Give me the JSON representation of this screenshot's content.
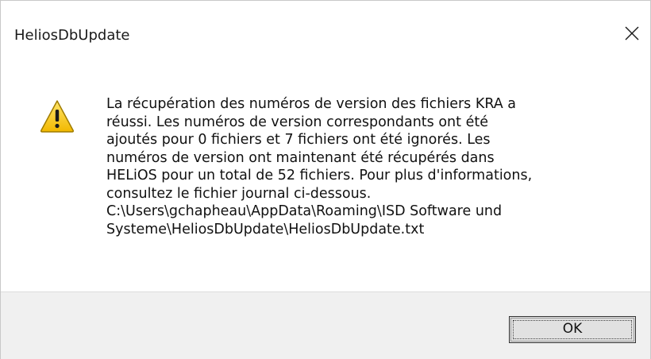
{
  "window": {
    "title": "HeliosDbUpdate",
    "close_icon": "close-icon"
  },
  "message": {
    "icon": "warning-icon",
    "text": "La récupération des numéros de version des fichiers KRA a\nréussi. Les numéros de version correspondants ont été\najoutés pour 0 fichiers et 7 fichiers ont été ignorés. Les\nnuméros de version ont maintenant été récupérés dans\nHELiOS pour un total de 52 fichiers. Pour plus d'informations,\nconsultez le fichier journal ci-dessous.\n C:\\Users\\gchapheau\\AppData\\Roaming\\ISD Software und\nSysteme\\HeliosDbUpdate\\HeliosDbUpdate.txt"
  },
  "buttons": {
    "ok_label": "OK"
  },
  "colors": {
    "warning_fill": "#f5c400",
    "warning_border": "#9a7a00",
    "footer_bg": "#f0f0f0"
  }
}
